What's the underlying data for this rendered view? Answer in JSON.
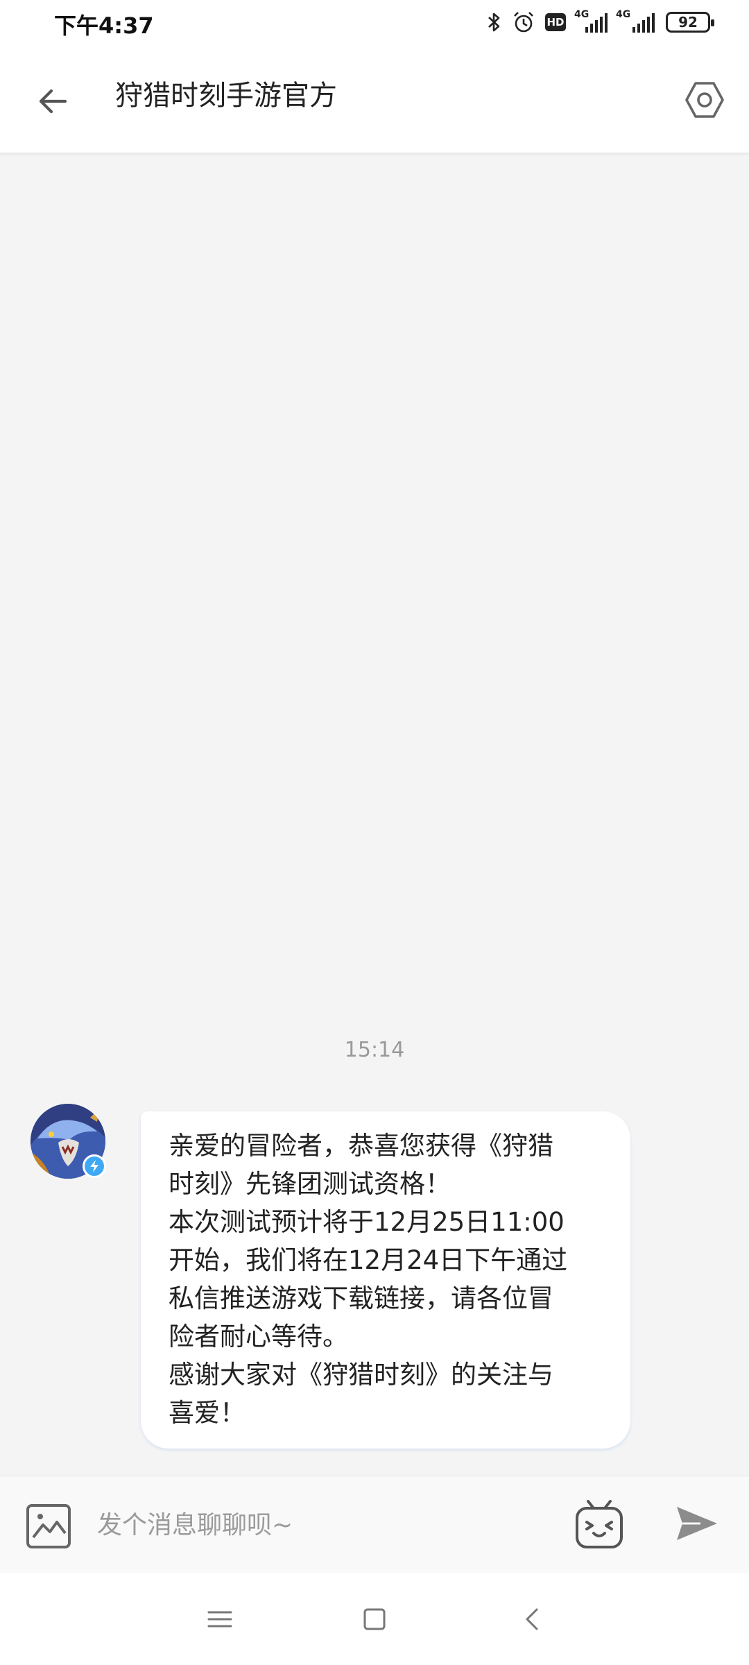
{
  "status_bar": {
    "time": "下午4:37",
    "hd_label": "HD",
    "network_1": "4G",
    "network_2": "4G",
    "battery": "92"
  },
  "header": {
    "title": "狩猎时刻手游官方",
    "back_icon": "arrow-left-icon",
    "settings_icon": "hexagon-settings-icon"
  },
  "conversation": {
    "timestamp": "15:14",
    "messages": [
      {
        "sender": "official",
        "avatar_icon": "dragon-avatar",
        "verified_icon": "lightning-badge-icon",
        "lines": [
          "亲爱的冒险者，恭喜您获得《狩猎",
          "时刻》先锋团测试资格！",
          "本次测试预计将于12月25日11:00",
          "开始，我们将在12月24日下午通过",
          "私信推送游戏下载链接，请各位冒",
          "险者耐心等待。",
          "感谢大家对《狩猎时刻》的关注与",
          "喜爱！"
        ]
      }
    ]
  },
  "composer": {
    "placeholder": "发个消息聊聊呗~",
    "image_icon": "image-icon",
    "emoji_icon": "tv-emoji-icon",
    "send_icon": "send-icon"
  },
  "nav_bar": {
    "menu_icon": "menu-icon",
    "home_icon": "home-square-icon",
    "back_icon": "chevron-left-icon"
  },
  "colors": {
    "background": "#f4f4f4",
    "bubble": "#ffffff",
    "accent_badge": "#3fa9f5",
    "placeholder": "#9a9a9a"
  }
}
